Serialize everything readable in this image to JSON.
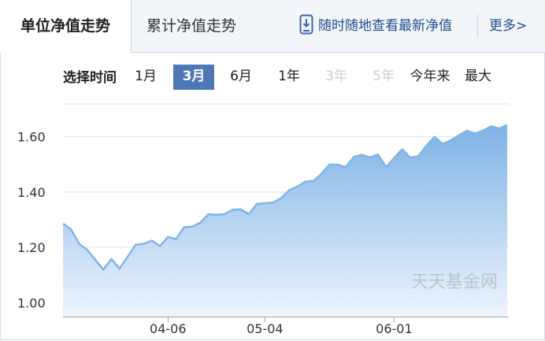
{
  "tabs": {
    "unit_nav": "单位净值走势",
    "cumulative_nav": "累计净值走势",
    "mobile_promo": "随时随地查看最新净值",
    "more": "更多>"
  },
  "period_selector": {
    "label": "选择时间",
    "options": [
      {
        "label": "1月",
        "state": "enabled"
      },
      {
        "label": "3月",
        "state": "active"
      },
      {
        "label": "6月",
        "state": "enabled"
      },
      {
        "label": "1年",
        "state": "enabled"
      },
      {
        "label": "3年",
        "state": "disabled"
      },
      {
        "label": "5年",
        "state": "disabled"
      },
      {
        "label": "今年来",
        "state": "enabled"
      },
      {
        "label": "最大",
        "state": "enabled"
      }
    ]
  },
  "watermark": "天天基金网",
  "colors": {
    "line": "#7fb4e8",
    "area_top": "#7eb2e6",
    "area_bottom": "#eef5fc",
    "active_tab": "#4e77b6",
    "grid": "#dde3ea"
  },
  "chart_data": {
    "type": "area",
    "title": "",
    "xlabel": "",
    "ylabel": "",
    "ylim": [
      0.95,
      1.73
    ],
    "y_ticks": [
      "1.00",
      "1.20",
      "1.40",
      "1.60"
    ],
    "x_ticks": [
      {
        "label": "04-06",
        "index": 13
      },
      {
        "label": "05-04",
        "index": 25
      },
      {
        "label": "06-01",
        "index": 41
      }
    ],
    "grid": "horizontal",
    "legend": "none",
    "series": [
      {
        "values": [
          1.286,
          1.265,
          1.213,
          1.191,
          1.155,
          1.12,
          1.158,
          1.123,
          1.166,
          1.21,
          1.213,
          1.225,
          1.205,
          1.238,
          1.23,
          1.273,
          1.275,
          1.289,
          1.32,
          1.318,
          1.32,
          1.336,
          1.338,
          1.32,
          1.357,
          1.36,
          1.362,
          1.378,
          1.407,
          1.42,
          1.438,
          1.44,
          1.466,
          1.5,
          1.499,
          1.49,
          1.527,
          1.535,
          1.525,
          1.536,
          1.49,
          1.523,
          1.555,
          1.525,
          1.53,
          1.568,
          1.6,
          1.574,
          1.587,
          1.605,
          1.622,
          1.612,
          1.622,
          1.638,
          1.63,
          1.643
        ]
      }
    ]
  }
}
